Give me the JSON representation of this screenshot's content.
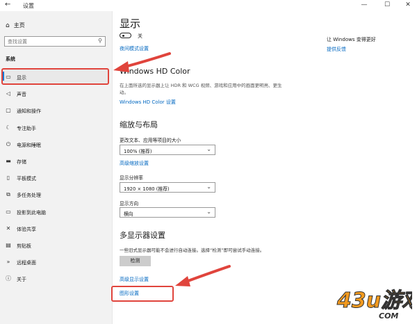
{
  "window": {
    "title": "设置",
    "back": "←",
    "min": "—",
    "max": "☐",
    "close": "✕"
  },
  "sidebar": {
    "home": "主页",
    "search_placeholder": "查找设置",
    "section": "系统",
    "items": [
      {
        "label": "显示",
        "icon": "monitor-icon",
        "glyph": "▭"
      },
      {
        "label": "声音",
        "icon": "speaker-icon",
        "glyph": "◁"
      },
      {
        "label": "通知和操作",
        "icon": "notification-icon",
        "glyph": "▢"
      },
      {
        "label": "专注助手",
        "icon": "moon-icon",
        "glyph": "☾"
      },
      {
        "label": "电源和睡眠",
        "icon": "power-icon",
        "glyph": "⏻"
      },
      {
        "label": "存储",
        "icon": "storage-icon",
        "glyph": "▬"
      },
      {
        "label": "平板模式",
        "icon": "tablet-icon",
        "glyph": "▯"
      },
      {
        "label": "多任务处理",
        "icon": "multitask-icon",
        "glyph": "⧉"
      },
      {
        "label": "投影到此电脑",
        "icon": "project-icon",
        "glyph": "▭"
      },
      {
        "label": "体验共享",
        "icon": "share-icon",
        "glyph": "✕"
      },
      {
        "label": "剪贴板",
        "icon": "clipboard-icon",
        "glyph": "▤"
      },
      {
        "label": "远程桌面",
        "icon": "remote-icon",
        "glyph": "»"
      },
      {
        "label": "关于",
        "icon": "info-icon",
        "glyph": "ⓘ"
      }
    ]
  },
  "main": {
    "title": "显示",
    "toggle_label": "关",
    "night_link": "夜间模式设置",
    "hd": {
      "title": "Windows HD Color",
      "desc": "在上面所选的显示器上让 HDR 和 WCG 视频、游戏和应用中的画面更明亮、更生动。",
      "link": "Windows HD Color 设置"
    },
    "scale": {
      "title": "缩放与布局",
      "size_label": "更改文本、应用等项目的大小",
      "size_value": "100% (推荐)",
      "adv_link": "高级缩放设置",
      "res_label": "显示分辨率",
      "res_value": "1920 × 1080 (推荐)",
      "orient_label": "显示方向",
      "orient_value": "横向"
    },
    "multi": {
      "title": "多显示器设置",
      "desc": "一些旧式显示器可能不会进行自动连接。选择“检测”即可尝试手动连接。",
      "detect_btn": "检测",
      "adv_display_link": "高级显示设置",
      "graphics_link": "图形设置"
    }
  },
  "right": {
    "heading": "让 Windows 变得更好",
    "feedback": "提供反馈"
  },
  "watermark": {
    "text": "43u游戏",
    "sub": "COM"
  },
  "colors": {
    "accent": "#0078d7",
    "link": "#0067c0",
    "annotation": "#e0443c",
    "watermark_orange": "#f29a1f"
  }
}
